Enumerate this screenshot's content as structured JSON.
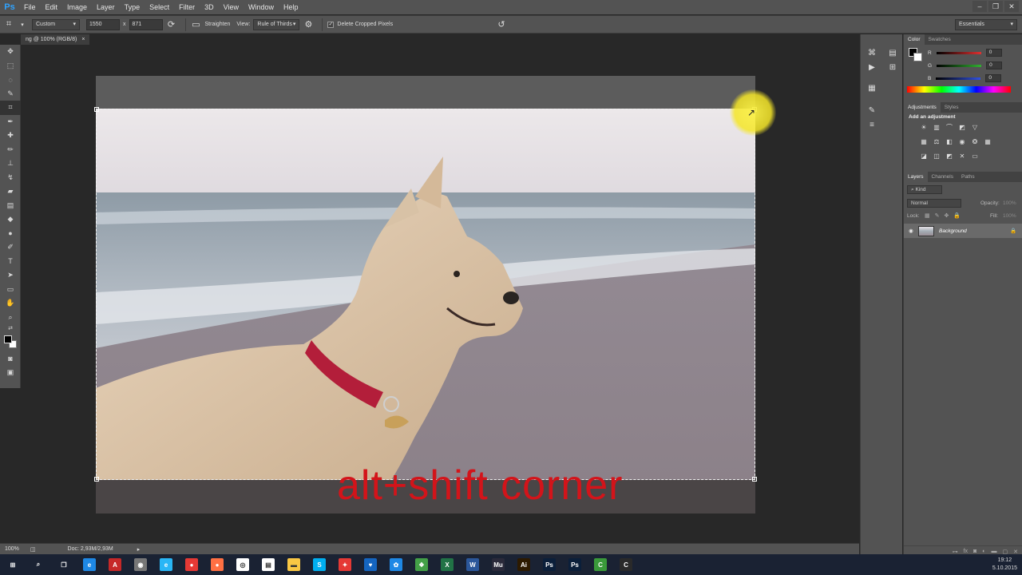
{
  "app": {
    "logo": "Ps",
    "menu": [
      "File",
      "Edit",
      "Image",
      "Layer",
      "Type",
      "Select",
      "Filter",
      "3D",
      "View",
      "Window",
      "Help"
    ],
    "window_controls": [
      "–",
      "❐",
      "✕"
    ]
  },
  "options_bar": {
    "preset": "Custom",
    "width": "1550",
    "x_label": "x",
    "height": "871",
    "straighten_label": "Straighten",
    "view_label": "View:",
    "view_value": "Rule of Thirds",
    "delete_cropped_label": "Delete Cropped Pixels",
    "workspace": "Essentials"
  },
  "document": {
    "tab_title": "ng @ 100% (RGB/8)",
    "tab_close": "×",
    "caption": "alt+shift corner"
  },
  "status_bar": {
    "zoom": "100%",
    "doc_info": "Doc: 2,93M/2,93M"
  },
  "color_panel": {
    "tabs": [
      "Color",
      "Swatches"
    ],
    "channels": [
      {
        "label": "R",
        "value": "0",
        "color": "#e03030"
      },
      {
        "label": "G",
        "value": "0",
        "color": "#30b030"
      },
      {
        "label": "B",
        "value": "0",
        "color": "#3050e0"
      }
    ]
  },
  "adjustments_panel": {
    "tabs": [
      "Adjustments",
      "Styles"
    ],
    "heading": "Add an adjustment"
  },
  "layers_panel": {
    "tabs": [
      "Layers",
      "Channels",
      "Paths"
    ],
    "filter_label": "Kind",
    "blend_mode": "Normal",
    "opacity_label": "Opacity:",
    "opacity_value": "100%",
    "lock_label": "Lock:",
    "fill_label": "Fill:",
    "fill_value": "100%",
    "layers": [
      {
        "name": "Background",
        "visible": true,
        "locked": true
      }
    ]
  },
  "taskbar": {
    "time": "19:12",
    "date": "5.10.2015",
    "apps": [
      {
        "name": "start",
        "glyph": "⊞",
        "color": "#1a2233"
      },
      {
        "name": "search",
        "glyph": "⌕",
        "color": "#1a2233"
      },
      {
        "name": "task-view",
        "glyph": "❐",
        "color": "#1a2233"
      },
      {
        "name": "edge",
        "glyph": "e",
        "color": "#1e88e5"
      },
      {
        "name": "acrobat",
        "glyph": "A",
        "color": "#c62828"
      },
      {
        "name": "app-grey",
        "glyph": "◉",
        "color": "#777777"
      },
      {
        "name": "ie",
        "glyph": "e",
        "color": "#29b6f6"
      },
      {
        "name": "media",
        "glyph": "●",
        "color": "#e53935"
      },
      {
        "name": "dot",
        "glyph": "●",
        "color": "#ff7043"
      },
      {
        "name": "chrome",
        "glyph": "◎",
        "color": "#ffffff"
      },
      {
        "name": "store",
        "glyph": "▤",
        "color": "#ffffff"
      },
      {
        "name": "explorer",
        "glyph": "▬",
        "color": "#f9c744"
      },
      {
        "name": "skype",
        "glyph": "S",
        "color": "#00aff0"
      },
      {
        "name": "app-red",
        "glyph": "✦",
        "color": "#e53935"
      },
      {
        "name": "app-blue",
        "glyph": "♥",
        "color": "#1565c0"
      },
      {
        "name": "app-photos",
        "glyph": "✿",
        "color": "#1e88e5"
      },
      {
        "name": "app-green",
        "glyph": "❖",
        "color": "#43a047"
      },
      {
        "name": "excel",
        "glyph": "X",
        "color": "#217346"
      },
      {
        "name": "word",
        "glyph": "W",
        "color": "#2b579a"
      },
      {
        "name": "muse",
        "glyph": "Mu",
        "color": "#2a2a3a"
      },
      {
        "name": "illustrator",
        "glyph": "Ai",
        "color": "#2d1a00"
      },
      {
        "name": "photoshop-1",
        "glyph": "Ps",
        "color": "#0b1f3a"
      },
      {
        "name": "photoshop-2",
        "glyph": "Ps",
        "color": "#0b1f3a"
      },
      {
        "name": "camtasia",
        "glyph": "C",
        "color": "#3a9a3a"
      },
      {
        "name": "app-c",
        "glyph": "C",
        "color": "#2a2a2a"
      }
    ]
  }
}
